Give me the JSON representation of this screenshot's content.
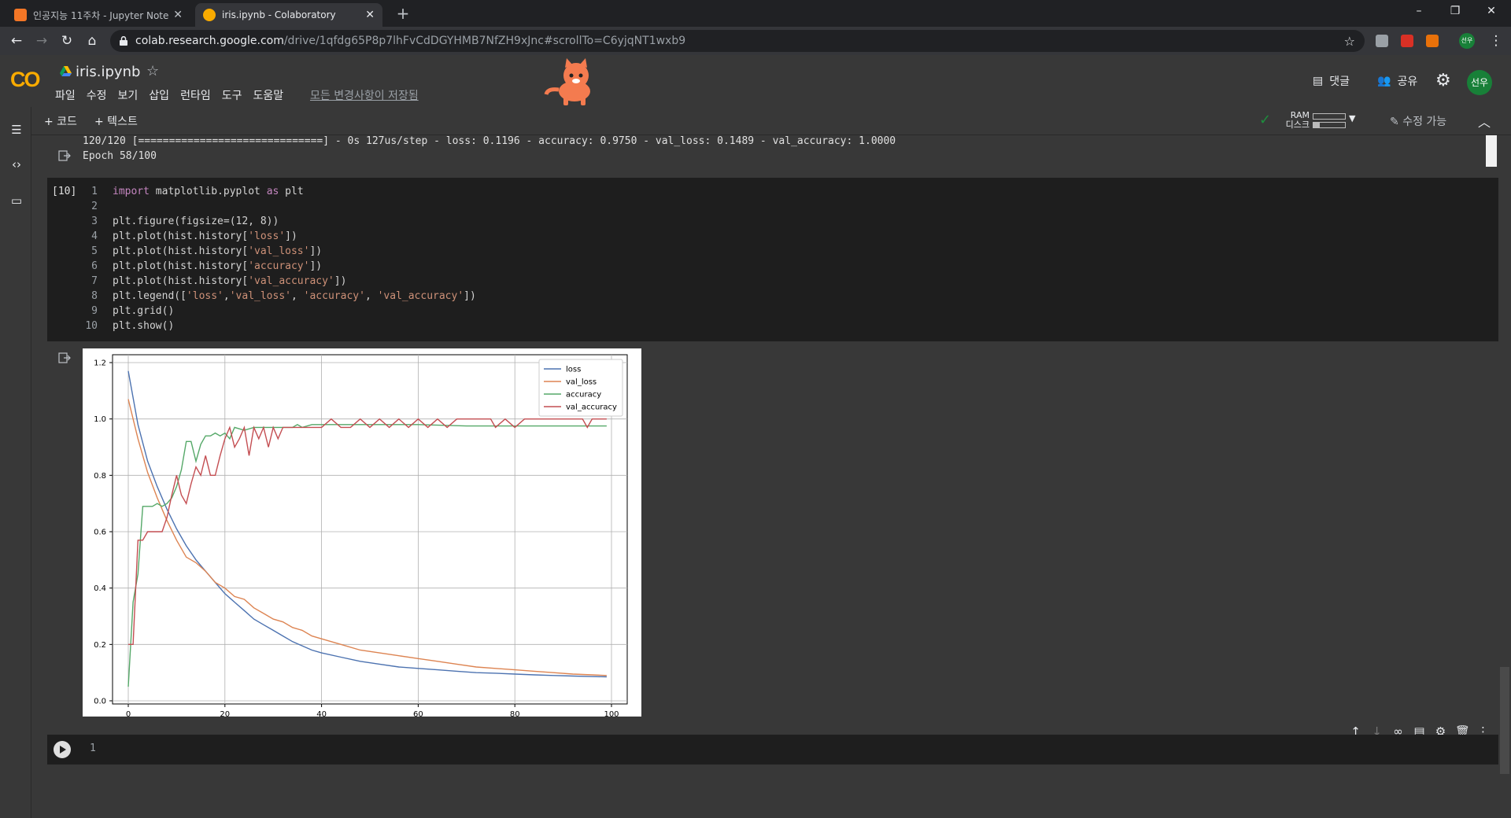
{
  "browser": {
    "tabs": [
      {
        "title": "인공지능 11주차 - Jupyter Notebook",
        "active": false
      },
      {
        "title": "iris.ipynb - Colaboratory",
        "active": true
      }
    ],
    "new_tab": "+",
    "window_buttons": [
      "–",
      "❐",
      "✕"
    ],
    "url_host": "colab.research.google.com",
    "url_path": "/drive/1qfdg65P8p7lhFvCdDGYHMB7NfZH9xJnc#scrollTo=C6yjqNT1wxb9",
    "profile": "선우"
  },
  "colab": {
    "logo": "CO",
    "notebook_title": "iris.ipynb",
    "menus": [
      "파일",
      "수정",
      "보기",
      "삽입",
      "런타임",
      "도구",
      "도움말"
    ],
    "saved_status": "모든 변경사항이 저장됨",
    "comment_label": "댓글",
    "share_label": "공유",
    "avatar": "선우",
    "add_code": "+ 코드",
    "add_text": "+ 텍스트",
    "ram_label": "RAM",
    "disk_label": "디스크",
    "edit_mode": "수정 가능"
  },
  "prev_output": [
    "120/120 [==============================] - 0s 127us/step - loss: 0.1196 - accuracy: 0.9750 - val_loss: 0.1489 - val_accuracy: 1.0000",
    "Epoch 58/100"
  ],
  "code_cell": {
    "exec_count": "[10]",
    "line_numbers": [
      "1",
      "2",
      "3",
      "4",
      "5",
      "6",
      "7",
      "8",
      "9",
      "10"
    ]
  },
  "empty_cell": {
    "line_number": "1"
  },
  "chart_data": {
    "type": "line",
    "xlim": [
      0,
      100
    ],
    "ylim": [
      0,
      1.2
    ],
    "xticks": [
      0,
      20,
      40,
      60,
      80,
      100
    ],
    "yticks": [
      0.0,
      0.2,
      0.4,
      0.6,
      0.8,
      1.0,
      1.2
    ],
    "grid": true,
    "legend_position": "top-right",
    "series": [
      {
        "name": "loss",
        "color": "#4c72b0",
        "points": [
          [
            0,
            1.17
          ],
          [
            2,
            0.98
          ],
          [
            4,
            0.85
          ],
          [
            6,
            0.76
          ],
          [
            8,
            0.68
          ],
          [
            10,
            0.61
          ],
          [
            12,
            0.55
          ],
          [
            14,
            0.5
          ],
          [
            16,
            0.46
          ],
          [
            18,
            0.42
          ],
          [
            20,
            0.38
          ],
          [
            22,
            0.35
          ],
          [
            24,
            0.32
          ],
          [
            26,
            0.29
          ],
          [
            28,
            0.27
          ],
          [
            30,
            0.25
          ],
          [
            32,
            0.23
          ],
          [
            34,
            0.21
          ],
          [
            36,
            0.195
          ],
          [
            38,
            0.18
          ],
          [
            40,
            0.17
          ],
          [
            44,
            0.155
          ],
          [
            48,
            0.14
          ],
          [
            52,
            0.13
          ],
          [
            56,
            0.12
          ],
          [
            60,
            0.115
          ],
          [
            64,
            0.11
          ],
          [
            68,
            0.105
          ],
          [
            72,
            0.1
          ],
          [
            76,
            0.098
          ],
          [
            80,
            0.095
          ],
          [
            84,
            0.092
          ],
          [
            88,
            0.09
          ],
          [
            92,
            0.088
          ],
          [
            96,
            0.086
          ],
          [
            99,
            0.085
          ]
        ]
      },
      {
        "name": "val_loss",
        "color": "#dd8452",
        "points": [
          [
            0,
            1.07
          ],
          [
            2,
            0.93
          ],
          [
            4,
            0.81
          ],
          [
            6,
            0.72
          ],
          [
            8,
            0.64
          ],
          [
            10,
            0.57
          ],
          [
            12,
            0.51
          ],
          [
            14,
            0.49
          ],
          [
            16,
            0.46
          ],
          [
            18,
            0.42
          ],
          [
            20,
            0.4
          ],
          [
            22,
            0.37
          ],
          [
            24,
            0.36
          ],
          [
            26,
            0.33
          ],
          [
            28,
            0.31
          ],
          [
            30,
            0.29
          ],
          [
            32,
            0.28
          ],
          [
            34,
            0.26
          ],
          [
            36,
            0.25
          ],
          [
            38,
            0.23
          ],
          [
            40,
            0.22
          ],
          [
            44,
            0.2
          ],
          [
            48,
            0.18
          ],
          [
            52,
            0.17
          ],
          [
            56,
            0.16
          ],
          [
            60,
            0.15
          ],
          [
            64,
            0.14
          ],
          [
            68,
            0.13
          ],
          [
            72,
            0.12
          ],
          [
            76,
            0.115
          ],
          [
            80,
            0.11
          ],
          [
            84,
            0.105
          ],
          [
            88,
            0.1
          ],
          [
            92,
            0.095
          ],
          [
            96,
            0.092
          ],
          [
            99,
            0.09
          ]
        ]
      },
      {
        "name": "accuracy",
        "color": "#55a868",
        "points": [
          [
            0,
            0.05
          ],
          [
            1,
            0.35
          ],
          [
            2,
            0.45
          ],
          [
            3,
            0.69
          ],
          [
            5,
            0.69
          ],
          [
            6,
            0.7
          ],
          [
            7,
            0.69
          ],
          [
            8,
            0.7
          ],
          [
            9,
            0.72
          ],
          [
            10,
            0.76
          ],
          [
            11,
            0.82
          ],
          [
            12,
            0.92
          ],
          [
            13,
            0.92
          ],
          [
            14,
            0.85
          ],
          [
            15,
            0.91
          ],
          [
            16,
            0.94
          ],
          [
            17,
            0.94
          ],
          [
            18,
            0.95
          ],
          [
            19,
            0.94
          ],
          [
            20,
            0.95
          ],
          [
            21,
            0.93
          ],
          [
            22,
            0.97
          ],
          [
            24,
            0.96
          ],
          [
            26,
            0.97
          ],
          [
            30,
            0.97
          ],
          [
            34,
            0.97
          ],
          [
            35,
            0.98
          ],
          [
            36,
            0.97
          ],
          [
            38,
            0.98
          ],
          [
            50,
            0.98
          ],
          [
            60,
            0.98
          ],
          [
            70,
            0.975
          ],
          [
            80,
            0.975
          ],
          [
            90,
            0.975
          ],
          [
            99,
            0.975
          ]
        ]
      },
      {
        "name": "val_accuracy",
        "color": "#c44e52",
        "points": [
          [
            0,
            0.2
          ],
          [
            1,
            0.2
          ],
          [
            2,
            0.57
          ],
          [
            3,
            0.57
          ],
          [
            4,
            0.6
          ],
          [
            7,
            0.6
          ],
          [
            8,
            0.65
          ],
          [
            9,
            0.73
          ],
          [
            10,
            0.8
          ],
          [
            11,
            0.73
          ],
          [
            12,
            0.7
          ],
          [
            13,
            0.77
          ],
          [
            14,
            0.83
          ],
          [
            15,
            0.8
          ],
          [
            16,
            0.87
          ],
          [
            17,
            0.8
          ],
          [
            18,
            0.8
          ],
          [
            19,
            0.87
          ],
          [
            20,
            0.93
          ],
          [
            21,
            0.97
          ],
          [
            22,
            0.9
          ],
          [
            23,
            0.93
          ],
          [
            24,
            0.97
          ],
          [
            25,
            0.87
          ],
          [
            26,
            0.97
          ],
          [
            27,
            0.93
          ],
          [
            28,
            0.97
          ],
          [
            29,
            0.9
          ],
          [
            30,
            0.97
          ],
          [
            31,
            0.93
          ],
          [
            32,
            0.97
          ],
          [
            36,
            0.97
          ],
          [
            40,
            0.97
          ],
          [
            42,
            1.0
          ],
          [
            44,
            0.97
          ],
          [
            46,
            0.97
          ],
          [
            48,
            1.0
          ],
          [
            50,
            0.97
          ],
          [
            52,
            1.0
          ],
          [
            54,
            0.97
          ],
          [
            56,
            1.0
          ],
          [
            58,
            0.97
          ],
          [
            60,
            1.0
          ],
          [
            62,
            0.97
          ],
          [
            64,
            1.0
          ],
          [
            66,
            0.97
          ],
          [
            68,
            1.0
          ],
          [
            72,
            1.0
          ],
          [
            75,
            1.0
          ],
          [
            76,
            0.97
          ],
          [
            78,
            1.0
          ],
          [
            80,
            0.97
          ],
          [
            82,
            1.0
          ],
          [
            90,
            1.0
          ],
          [
            94,
            1.0
          ],
          [
            95,
            0.97
          ],
          [
            96,
            1.0
          ],
          [
            99,
            1.0
          ]
        ]
      }
    ]
  }
}
